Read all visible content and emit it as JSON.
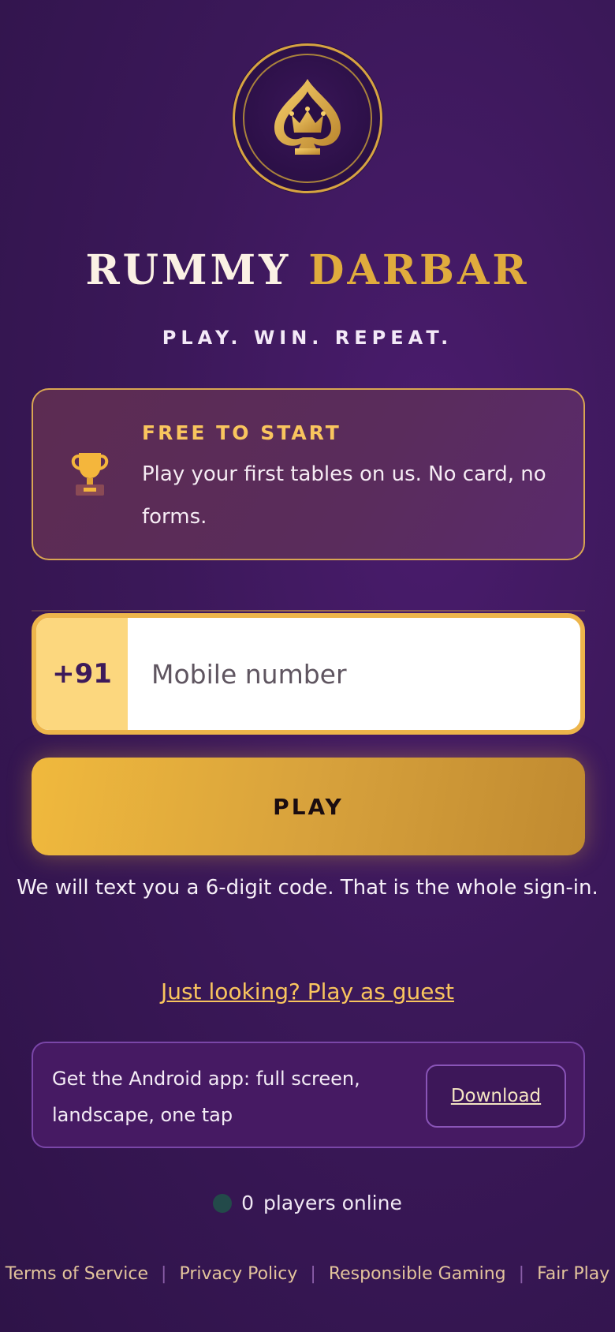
{
  "brand": {
    "word1": "RUMMY",
    "word2": "DARBAR",
    "tagline": "PLAY. WIN. REPEAT."
  },
  "logo": {
    "icon": "spade-crown-icon",
    "colors": {
      "gold": "#d7a441",
      "bg": "#2a0f45"
    }
  },
  "promo": {
    "icon": "trophy-icon",
    "title": "FREE TO START",
    "text": "Play your first tables on us. No card, no forms."
  },
  "login": {
    "country_code": "+91",
    "phone_placeholder": "Mobile number",
    "phone_value": "",
    "play_label": "PLAY",
    "note": "We will text you a 6-digit code. That is the whole sign-in."
  },
  "guest_link": "Just looking? Play as guest",
  "android": {
    "text": "Get the Android app: full screen, landscape, one tap",
    "download_label": "Download"
  },
  "online": {
    "count": "0",
    "label": "players online"
  },
  "footer": {
    "links": [
      "Terms of Service",
      "Privacy Policy",
      "Responsible Gaming",
      "Fair Play"
    ],
    "separator": "|"
  },
  "colors": {
    "accent": "#edb54b",
    "gold_text": "#f9c55e",
    "background": "#3b1859"
  }
}
